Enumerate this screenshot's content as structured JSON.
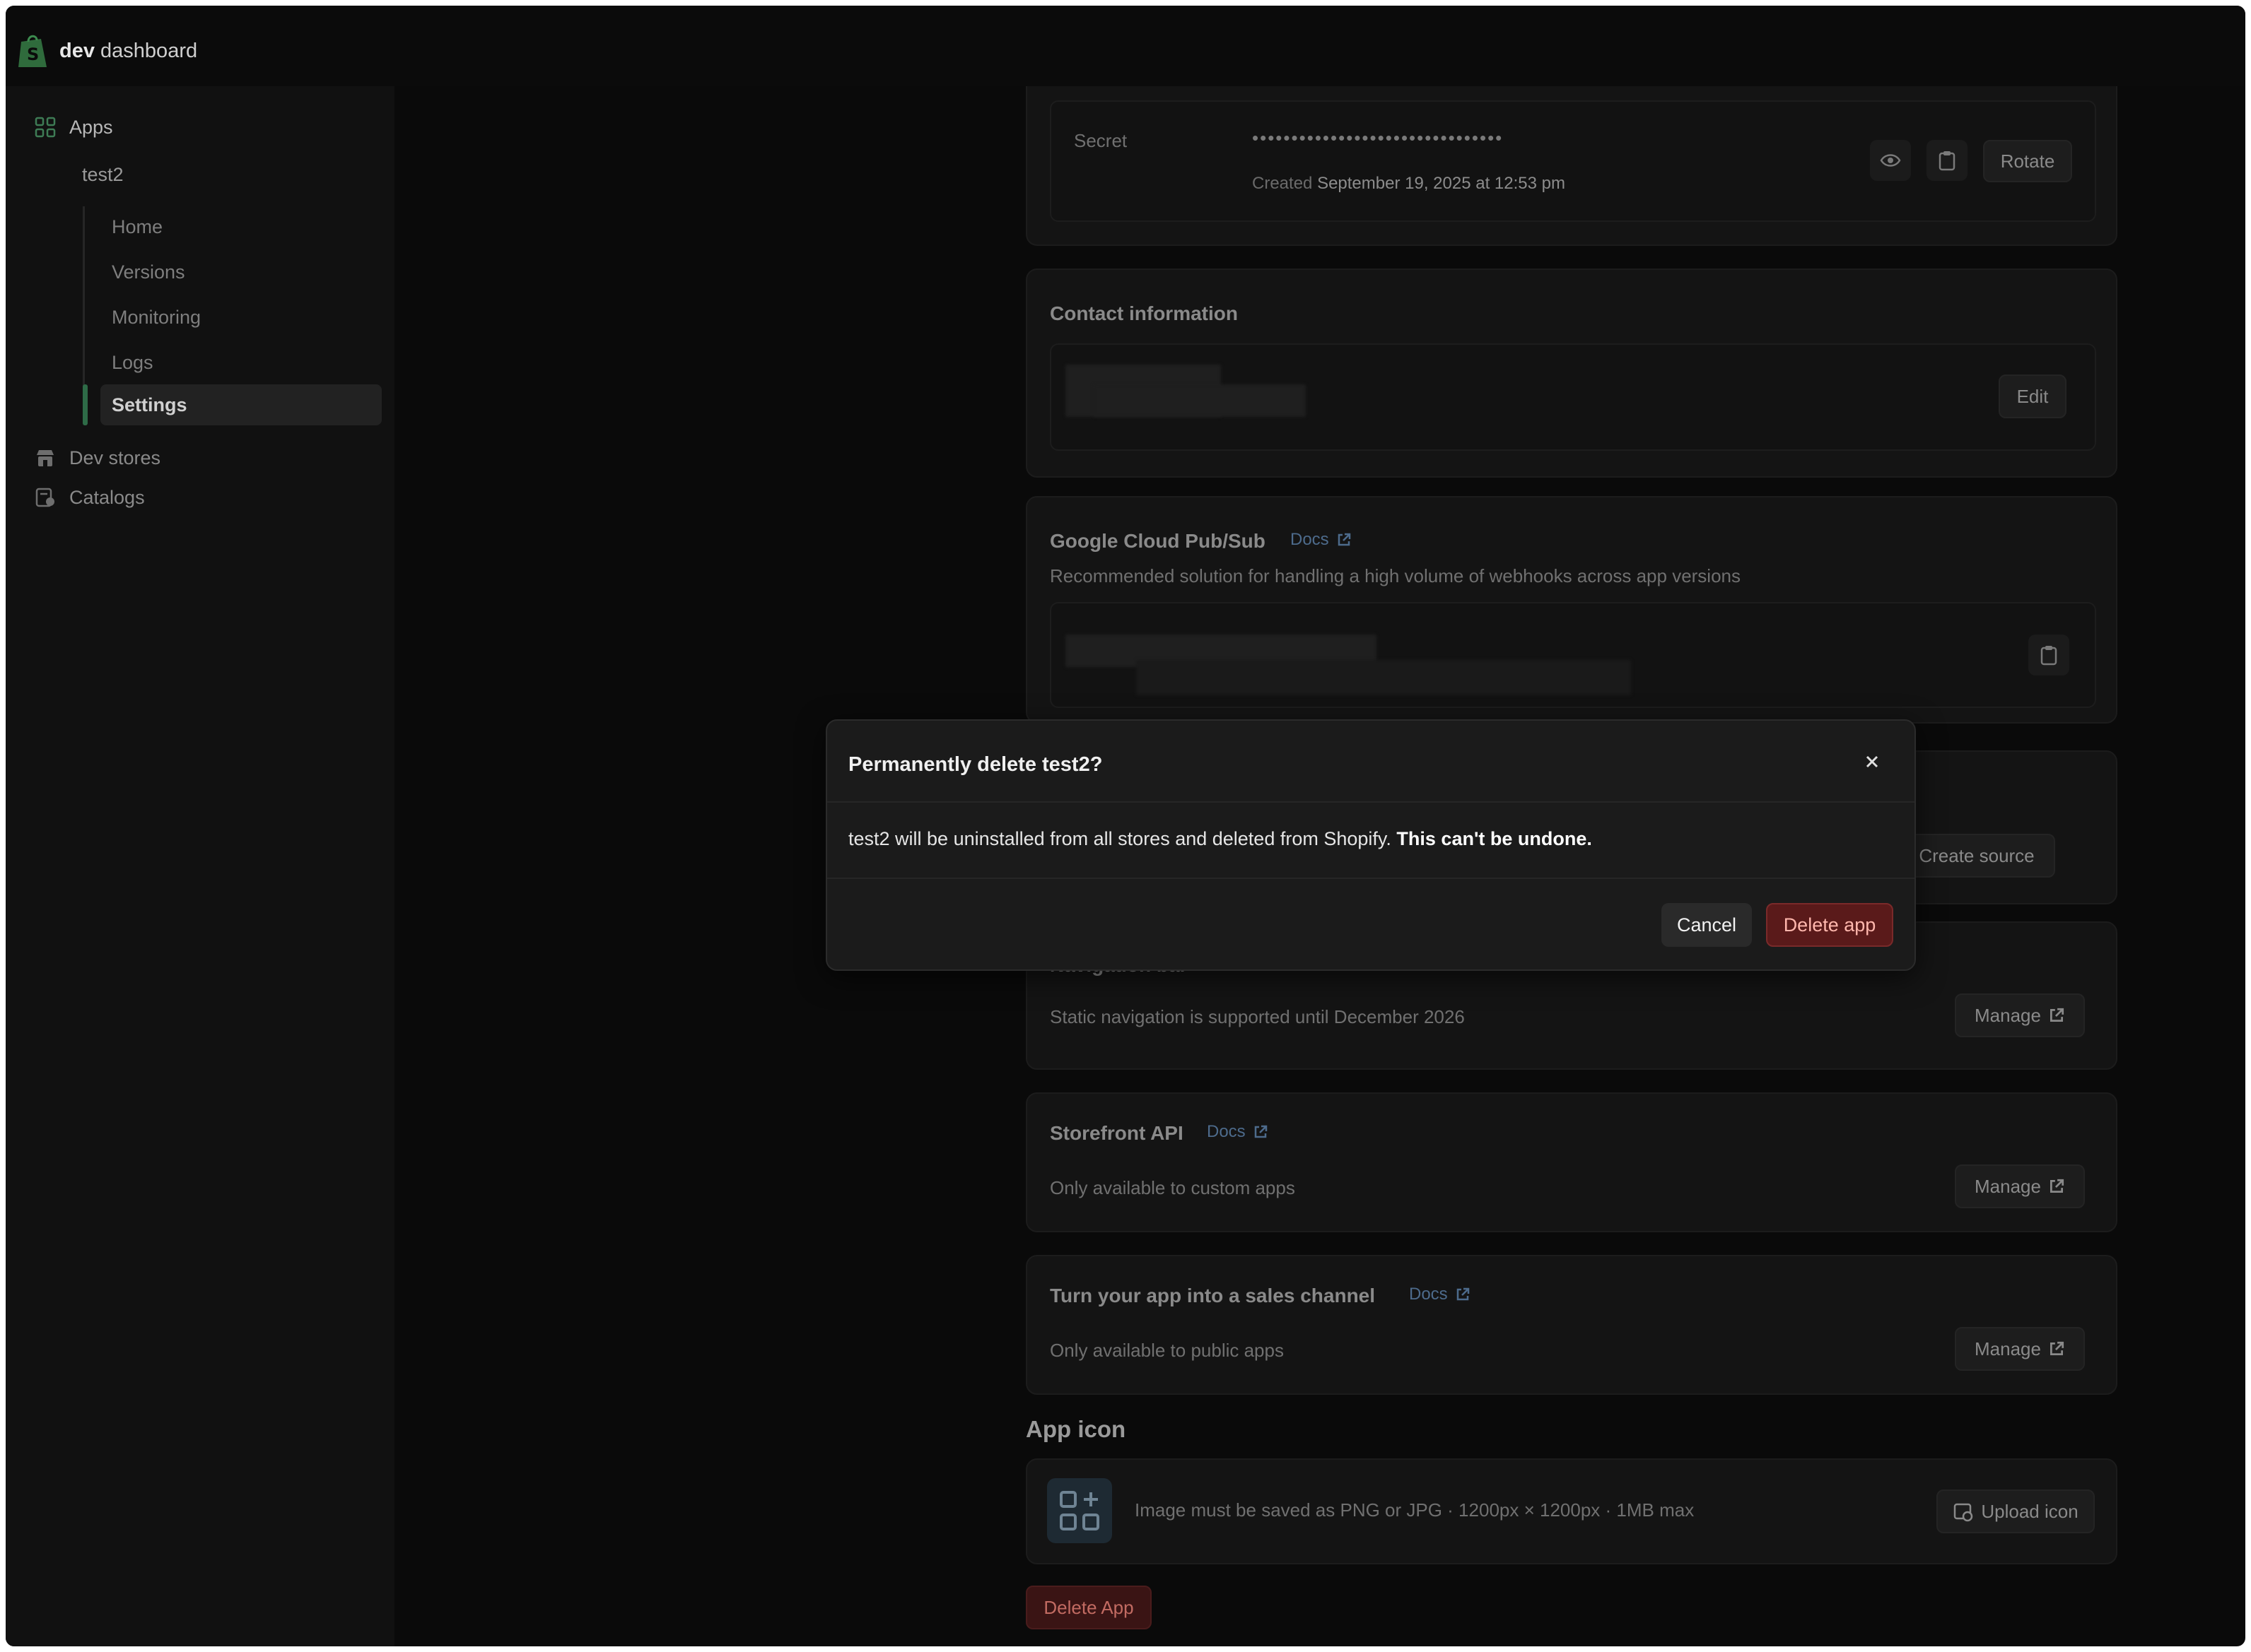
{
  "brand": {
    "bold": "dev",
    "rest": "dashboard"
  },
  "sidebar": {
    "apps_label": "Apps",
    "app_name": "test2",
    "subnav": [
      "Home",
      "Versions",
      "Monitoring",
      "Logs",
      "Settings"
    ],
    "active_subnav": "Settings",
    "dev_stores": "Dev stores",
    "catalogs": "Catalogs"
  },
  "secret": {
    "label": "Secret",
    "masked": "••••••••••••••••••••••••••••••••",
    "created_prefix": "Created",
    "created_date": "September 19, 2025 at 12:53 pm",
    "rotate_label": "Rotate"
  },
  "contact": {
    "title": "Contact information",
    "edit_label": "Edit"
  },
  "pubsub": {
    "title": "Google Cloud Pub/Sub",
    "docs": "Docs",
    "subtitle": "Recommended solution for handling a high volume of webhooks across app versions"
  },
  "source": {
    "create_label": "Create source"
  },
  "navbar": {
    "title": "Navigation bar",
    "subtitle": "Static navigation is supported until December 2026",
    "manage_label": "Manage"
  },
  "storefront": {
    "title": "Storefront API",
    "docs": "Docs",
    "subtitle": "Only available to custom apps",
    "manage_label": "Manage"
  },
  "sales_channel": {
    "title": "Turn your app into a sales channel",
    "docs": "Docs",
    "subtitle": "Only available to public apps",
    "manage_label": "Manage"
  },
  "app_icon": {
    "heading": "App icon",
    "hint": "Image must be saved as PNG or JPG · 1200px × 1200px · 1MB max",
    "upload_label": "Upload icon"
  },
  "delete_app_label": "Delete App",
  "modal": {
    "title": "Permanently delete test2?",
    "body": "test2 will be uninstalled from all stores and deleted from Shopify.",
    "body_bold": "This can't be undone.",
    "cancel_label": "Cancel",
    "delete_label": "Delete app"
  },
  "colors": {
    "accent_green": "#2e6b47",
    "danger_bg": "#5a1a1a",
    "danger_text": "#ffb7ad",
    "link": "#4d6b8c"
  }
}
